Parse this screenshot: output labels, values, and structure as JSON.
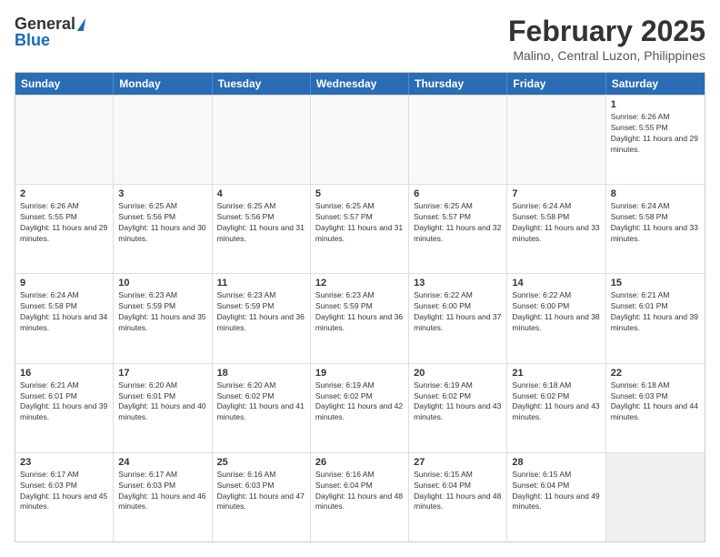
{
  "logo": {
    "general": "General",
    "blue": "Blue"
  },
  "title": {
    "month_year": "February 2025",
    "location": "Malino, Central Luzon, Philippines"
  },
  "days_of_week": [
    "Sunday",
    "Monday",
    "Tuesday",
    "Wednesday",
    "Thursday",
    "Friday",
    "Saturday"
  ],
  "weeks": [
    [
      {
        "day": "",
        "info": ""
      },
      {
        "day": "",
        "info": ""
      },
      {
        "day": "",
        "info": ""
      },
      {
        "day": "",
        "info": ""
      },
      {
        "day": "",
        "info": ""
      },
      {
        "day": "",
        "info": ""
      },
      {
        "day": "1",
        "info": "Sunrise: 6:26 AM\nSunset: 5:55 PM\nDaylight: 11 hours and 29 minutes."
      }
    ],
    [
      {
        "day": "2",
        "info": "Sunrise: 6:26 AM\nSunset: 5:55 PM\nDaylight: 11 hours and 29 minutes."
      },
      {
        "day": "3",
        "info": "Sunrise: 6:25 AM\nSunset: 5:56 PM\nDaylight: 11 hours and 30 minutes."
      },
      {
        "day": "4",
        "info": "Sunrise: 6:25 AM\nSunset: 5:56 PM\nDaylight: 11 hours and 31 minutes."
      },
      {
        "day": "5",
        "info": "Sunrise: 6:25 AM\nSunset: 5:57 PM\nDaylight: 11 hours and 31 minutes."
      },
      {
        "day": "6",
        "info": "Sunrise: 6:25 AM\nSunset: 5:57 PM\nDaylight: 11 hours and 32 minutes."
      },
      {
        "day": "7",
        "info": "Sunrise: 6:24 AM\nSunset: 5:58 PM\nDaylight: 11 hours and 33 minutes."
      },
      {
        "day": "8",
        "info": "Sunrise: 6:24 AM\nSunset: 5:58 PM\nDaylight: 11 hours and 33 minutes."
      }
    ],
    [
      {
        "day": "9",
        "info": "Sunrise: 6:24 AM\nSunset: 5:58 PM\nDaylight: 11 hours and 34 minutes."
      },
      {
        "day": "10",
        "info": "Sunrise: 6:23 AM\nSunset: 5:59 PM\nDaylight: 11 hours and 35 minutes."
      },
      {
        "day": "11",
        "info": "Sunrise: 6:23 AM\nSunset: 5:59 PM\nDaylight: 11 hours and 36 minutes."
      },
      {
        "day": "12",
        "info": "Sunrise: 6:23 AM\nSunset: 5:59 PM\nDaylight: 11 hours and 36 minutes."
      },
      {
        "day": "13",
        "info": "Sunrise: 6:22 AM\nSunset: 6:00 PM\nDaylight: 11 hours and 37 minutes."
      },
      {
        "day": "14",
        "info": "Sunrise: 6:22 AM\nSunset: 6:00 PM\nDaylight: 11 hours and 38 minutes."
      },
      {
        "day": "15",
        "info": "Sunrise: 6:21 AM\nSunset: 6:01 PM\nDaylight: 11 hours and 39 minutes."
      }
    ],
    [
      {
        "day": "16",
        "info": "Sunrise: 6:21 AM\nSunset: 6:01 PM\nDaylight: 11 hours and 39 minutes."
      },
      {
        "day": "17",
        "info": "Sunrise: 6:20 AM\nSunset: 6:01 PM\nDaylight: 11 hours and 40 minutes."
      },
      {
        "day": "18",
        "info": "Sunrise: 6:20 AM\nSunset: 6:02 PM\nDaylight: 11 hours and 41 minutes."
      },
      {
        "day": "19",
        "info": "Sunrise: 6:19 AM\nSunset: 6:02 PM\nDaylight: 11 hours and 42 minutes."
      },
      {
        "day": "20",
        "info": "Sunrise: 6:19 AM\nSunset: 6:02 PM\nDaylight: 11 hours and 43 minutes."
      },
      {
        "day": "21",
        "info": "Sunrise: 6:18 AM\nSunset: 6:02 PM\nDaylight: 11 hours and 43 minutes."
      },
      {
        "day": "22",
        "info": "Sunrise: 6:18 AM\nSunset: 6:03 PM\nDaylight: 11 hours and 44 minutes."
      }
    ],
    [
      {
        "day": "23",
        "info": "Sunrise: 6:17 AM\nSunset: 6:03 PM\nDaylight: 11 hours and 45 minutes."
      },
      {
        "day": "24",
        "info": "Sunrise: 6:17 AM\nSunset: 6:03 PM\nDaylight: 11 hours and 46 minutes."
      },
      {
        "day": "25",
        "info": "Sunrise: 6:16 AM\nSunset: 6:03 PM\nDaylight: 11 hours and 47 minutes."
      },
      {
        "day": "26",
        "info": "Sunrise: 6:16 AM\nSunset: 6:04 PM\nDaylight: 11 hours and 48 minutes."
      },
      {
        "day": "27",
        "info": "Sunrise: 6:15 AM\nSunset: 6:04 PM\nDaylight: 11 hours and 48 minutes."
      },
      {
        "day": "28",
        "info": "Sunrise: 6:15 AM\nSunset: 6:04 PM\nDaylight: 11 hours and 49 minutes."
      },
      {
        "day": "",
        "info": ""
      }
    ]
  ]
}
